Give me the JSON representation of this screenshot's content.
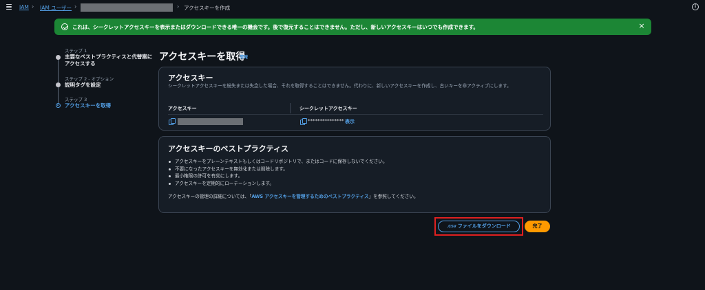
{
  "breadcrumb": {
    "iam": "IAM",
    "users": "IAM ユーザー",
    "current": "アクセスキーを作成"
  },
  "flash": {
    "message": "これは、シークレットアクセスキーを表示またはダウンロードできる唯一の機会です。後で復元することはできません。ただし、新しいアクセスキーはいつでも作成できます。",
    "close": "×"
  },
  "steps": [
    {
      "number": "ステップ 1",
      "title": "主要なベストプラクティスと代替案にアクセスする"
    },
    {
      "number": "ステップ 2 - オプション",
      "title": "説明タグを設定"
    },
    {
      "number": "ステップ 3",
      "title": "アクセスキーを取得"
    }
  ],
  "page": {
    "title": "アクセスキーを取得",
    "info": "情報"
  },
  "access_key_panel": {
    "title": "アクセスキー",
    "description": "シークレットアクセスキーを紛失または失念した場合、それを取得することはできません。代わりに、新しいアクセスキーを作成し、古いキーを非アクティブにします。",
    "col_access_key": "アクセスキー",
    "col_secret_key": "シークレットアクセスキー",
    "secret_mask": "***************",
    "show": "表示"
  },
  "best_practices": {
    "title": "アクセスキーのベストプラクティス",
    "items": [
      "アクセスキーをプレーンテキストもしくはコードリポジトリで、またはコードに保存しないでください。",
      "不要になったアクセスキーを無効化または削除します。",
      "最小権限の許可を有効にします。",
      "アクセスキーを定期的にローテーションします。"
    ],
    "footer_before": "アクセスキーの管理の詳細については、「",
    "footer_link": "AWS アクセスキーを管理するためのベストプラクティス",
    "footer_after": "」を参照してください。"
  },
  "buttons": {
    "download_csv": ".csv ファイルをダウンロード",
    "done": "完了"
  },
  "colors": {
    "accent": "#539fe5",
    "success": "#1c8635",
    "primary": "#ff9900",
    "highlight": "#e02020"
  }
}
